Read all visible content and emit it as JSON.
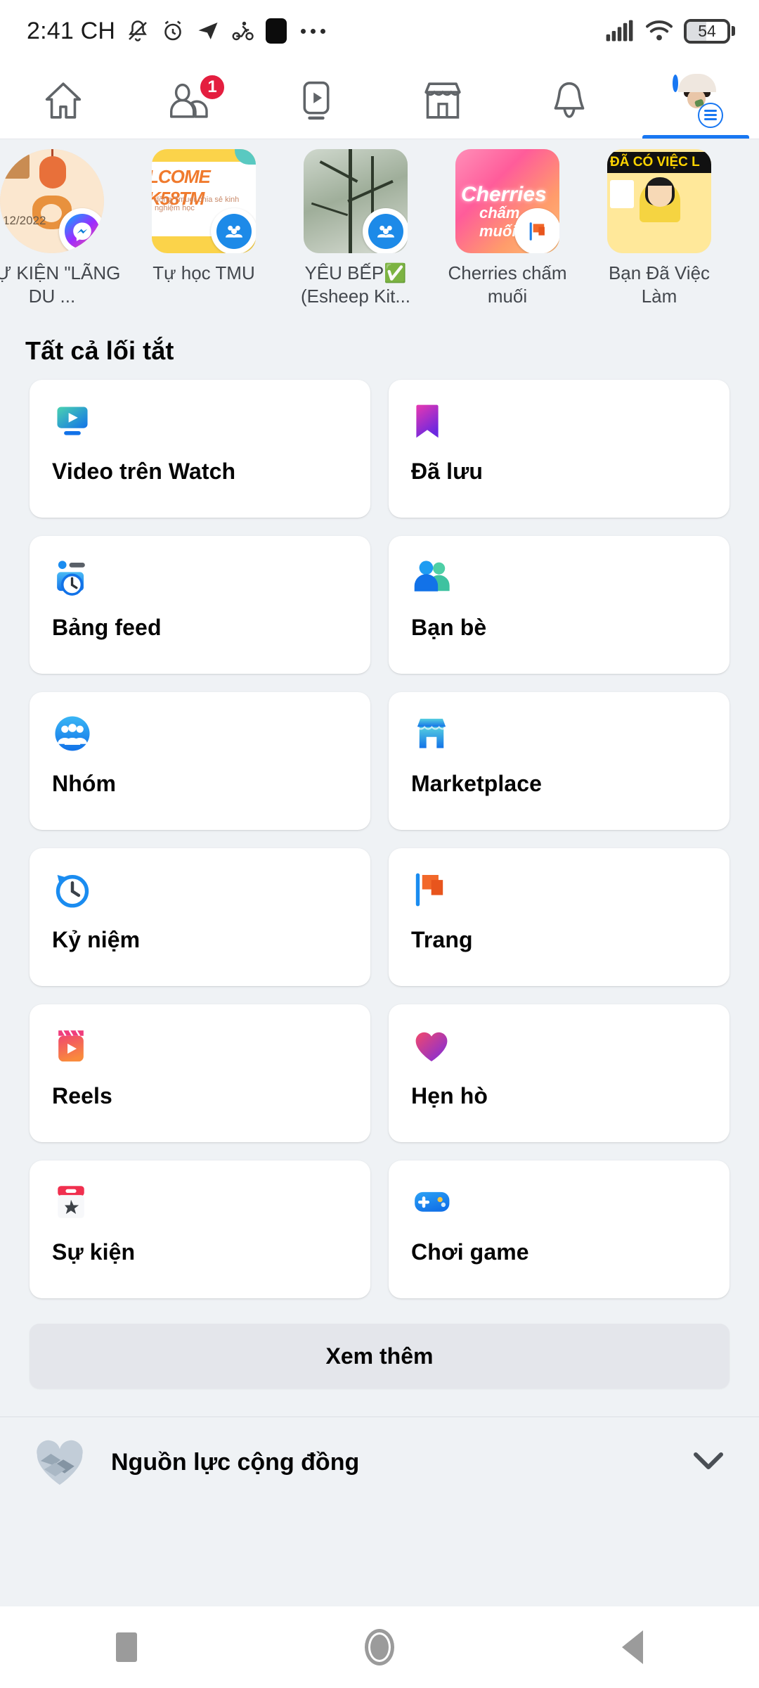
{
  "status_bar": {
    "time": "2:41 CH",
    "left_icons": [
      "bell-off-icon",
      "alarm-icon",
      "telegram-icon",
      "motorbike-icon",
      "app-icon",
      "more-dots-icon"
    ],
    "battery_percent": "54",
    "right_icons": [
      "signal-icon",
      "wifi-icon",
      "battery-icon"
    ]
  },
  "top_nav": {
    "tabs": [
      {
        "name": "home",
        "icon": "home-icon",
        "badge": "",
        "active": false
      },
      {
        "name": "friends",
        "icon": "friends-icon",
        "badge": "1",
        "active": false
      },
      {
        "name": "watch",
        "icon": "watch-video-icon",
        "badge": "",
        "active": false
      },
      {
        "name": "marketplace",
        "icon": "marketplace-icon",
        "badge": "",
        "active": false
      },
      {
        "name": "notifications",
        "icon": "bell-icon",
        "badge": "",
        "active": false
      },
      {
        "name": "menu",
        "icon": "profile-avatar-icon",
        "badge": "",
        "active": true
      }
    ]
  },
  "shortcut_strip": {
    "items": [
      {
        "label": "SỰ KIỆN \"LÃNG DU ...",
        "badge": "messenger-icon",
        "thumb": "tet-tiger-thumb",
        "date_text": "12/2022"
      },
      {
        "label": "Tự học TMU",
        "badge": "group-icon",
        "thumb": "welcome-k58tm-thumb",
        "title_text": "LCOME K58TM",
        "sub_text": "dồng Tmuer chia sẻ kinh nghiệm học"
      },
      {
        "label": "YÊU BẾP✅ (Esheep Kit...",
        "badge": "group-icon",
        "thumb": "winter-tree-thumb"
      },
      {
        "label": "Cherries chấm muối",
        "badge": "page-flag-icon",
        "thumb": "cherries-thumb",
        "title_text": "Cherries",
        "sub_text": "chấm muối"
      },
      {
        "label": "Bạn Đã Việc Làm",
        "badge": "page-flag-icon",
        "thumb": "job-thumb",
        "title_text": "ĐÃ CÓ VIỆC L"
      }
    ]
  },
  "main": {
    "section_title": "Tất cả lối tắt",
    "shortcuts": [
      {
        "label": "Video trên Watch",
        "icon": "watch-icon"
      },
      {
        "label": "Đã lưu",
        "icon": "bookmark-icon"
      },
      {
        "label": "Bảng feed",
        "icon": "feeds-icon"
      },
      {
        "label": "Bạn bè",
        "icon": "friends-icon"
      },
      {
        "label": "Nhóm",
        "icon": "groups-icon"
      },
      {
        "label": "Marketplace",
        "icon": "marketplace-icon"
      },
      {
        "label": "Kỷ niệm",
        "icon": "memories-clock-icon"
      },
      {
        "label": "Trang",
        "icon": "pages-flag-icon"
      },
      {
        "label": "Reels",
        "icon": "reels-icon"
      },
      {
        "label": "Hẹn hò",
        "icon": "dating-heart-icon"
      },
      {
        "label": "Sự kiện",
        "icon": "events-calendar-icon"
      },
      {
        "label": "Chơi game",
        "icon": "gaming-controller-icon"
      }
    ],
    "see_more_label": "Xem thêm"
  },
  "community": {
    "label": "Nguồn lực cộng đồng",
    "icon": "handshake-heart-icon",
    "chevron": "chevron-down-icon"
  },
  "android_nav": {
    "buttons": [
      {
        "name": "recents-button",
        "icon": "square-icon"
      },
      {
        "name": "home-button",
        "icon": "circle-icon"
      },
      {
        "name": "back-button",
        "icon": "triangle-back-icon"
      }
    ]
  },
  "colors": {
    "background": "#eff2f5",
    "card": "#ffffff",
    "accent_blue": "#1877f2",
    "badge_red": "#e41e3f",
    "text_primary": "#050505",
    "text_secondary": "#43474d",
    "see_more_bg": "#e4e6eb"
  }
}
